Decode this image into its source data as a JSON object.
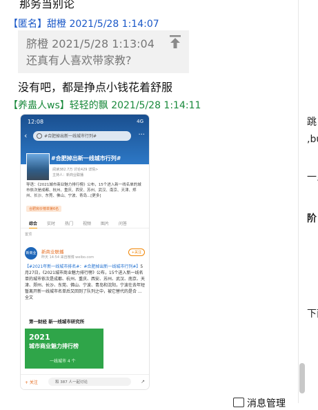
{
  "chat": {
    "top_cut_text": "那务当别论",
    "msg1": {
      "header": "【匿名】甜橙 2021/5/28 1:14:07",
      "quote_header": "脐橙  2021/5/28 1:13:04",
      "quote_text": "还真有人喜欢带家教?",
      "text": "没有吧，都是挣点小钱花着舒服"
    },
    "msg2": {
      "header": "【养蛊人ws】轻轻的飘 2021/5/28 1:14:11"
    }
  },
  "phone_screenshot": {
    "status_time": "12:08",
    "signal": "4G",
    "search_text": "#合肥掉出新一线城市行列#",
    "topic_title": "#合肥掉出新一线城市行列#",
    "topic_meta": "阅读382.7万  讨论429  详情>",
    "topic_host": "主持人：新商业联播",
    "intro": "导语：《2021城市商业魅力排行榜》公布，15个进入新一线名单的城市依次是成都、杭州、重庆、西安、苏州、武汉、南京、天津、郑州、长沙、东莞、佛山、宁波、青岛...[更多]",
    "tag": "合肥房价榜单第6名",
    "tabs": [
      "综合",
      "实时",
      "热门",
      "视频",
      "图片",
      "问答"
    ],
    "section": "置顶",
    "post_avatar": "新商业联播",
    "post_name": "新商业联播",
    "post_time": "昨天 14:54 来自微博 weibo.com",
    "follow": "+关注",
    "post_hashtags": "【#2021年新一线城市排名#：#合肥掉出新一线城市行列#】",
    "post_text": "5月27日，《2021城市商业魅力排行榜》公布，15个进入新一线名单的城市依次是成都、杭州、重庆、西安、苏州、武汉、南京、天津、郑州、长沙、东莞、佛山、宁波、青岛和沈阳，宁波在去年短暂离开新一线城市名单后又回到了队列之中，被它替代的是合 ... 全文",
    "brand": "第一财经  新一线城市研究所",
    "image_year": "2021",
    "image_title": "城市商业魅力排行榜",
    "image_sub": "一线城市 4 个",
    "bottom_follow": "+ 关注",
    "discuss": "和 387 人一起讨论"
  },
  "right_panel": {
    "texts": [
      "跳",
      ",bu",
      "一乡",
      "阶",
      "下面"
    ]
  },
  "footer": {
    "manage_label": "消息管理"
  }
}
